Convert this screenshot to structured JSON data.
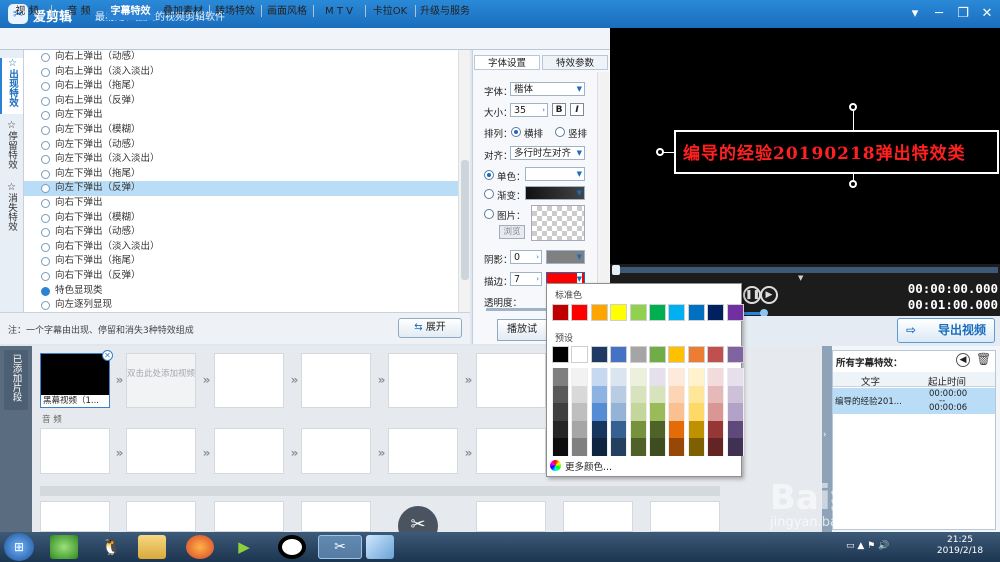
{
  "app": {
    "logo_glyph": "✂",
    "title": "爱剪辑",
    "subtitle": "最易用、强大的视频剪辑软件"
  },
  "tabs": [
    {
      "label": "视  频"
    },
    {
      "label": "音  频"
    },
    {
      "label": "字幕特效"
    },
    {
      "label": "叠加素材"
    },
    {
      "label": "转场特效"
    },
    {
      "label": "画面风格"
    },
    {
      "label": "M T V"
    },
    {
      "label": "卡拉OK"
    },
    {
      "label": "升级与服务"
    }
  ],
  "side_tabs": [
    {
      "label": "出现特效"
    },
    {
      "label": "停留特效"
    },
    {
      "label": "消失特效"
    }
  ],
  "effects": [
    {
      "label": "向右上弹出（动感）"
    },
    {
      "label": "向右上弹出（淡入淡出）"
    },
    {
      "label": "向右上弹出（拖尾）"
    },
    {
      "label": "向右上弹出（反弹）"
    },
    {
      "label": "向左下弹出"
    },
    {
      "label": "向左下弹出（模糊）"
    },
    {
      "label": "向左下弹出（动感）"
    },
    {
      "label": "向左下弹出（淡入淡出）"
    },
    {
      "label": "向左下弹出（拖尾）"
    },
    {
      "label": "向左下弹出（反弹）"
    },
    {
      "label": "向右下弹出"
    },
    {
      "label": "向右下弹出（模糊）"
    },
    {
      "label": "向右下弹出（动感）"
    },
    {
      "label": "向右下弹出（淡入淡出）"
    },
    {
      "label": "向右下弹出（拖尾）"
    },
    {
      "label": "向右下弹出（反弹）"
    }
  ],
  "effect_selected": "向左下弹出（反弹）",
  "category": {
    "label": "特色显现类",
    "first_item": "向左逐列显现"
  },
  "note": "注：一个字幕由出现、停留和消失3种特效组成",
  "expand_label": "展开",
  "props": {
    "tab_font": "字体设置",
    "tab_effect": "特效参数",
    "font_label": "字体：",
    "font_value": "楷体",
    "size_label": "大小：",
    "size_value": "35",
    "bold": "B",
    "italic": "I",
    "layout_label": "排列：",
    "layout_h": "横排",
    "layout_v": "竖排",
    "align_label": "对齐：",
    "align_value": "多行时左对齐",
    "solid_label": "单色：",
    "gradient_label": "渐变：",
    "image_label": "图片：",
    "browse_label": "浏览",
    "shadow_label": "阴影：",
    "shadow_value": "0",
    "stroke_label": "描边：",
    "stroke_value": "7",
    "opacity_label": "透明度："
  },
  "preview": {
    "caption": "编导的经验20190218弹出特效类"
  },
  "time": {
    "current": "00:00:00.000",
    "total": "00:01:00.000"
  },
  "play_label": "播放试",
  "export_label": "导出视频",
  "timeline": {
    "section_label": "已添加片段",
    "clip_label": "黑幕视频（1...",
    "add_hint": "双击此处添加视频",
    "audio_label": "音  频"
  },
  "right_panel": {
    "title": "所有字幕特效：",
    "col_text": "文字",
    "col_time": "起止时间",
    "row_text": "编导的经验201...",
    "row_start": "00:00:00",
    "row_sep": "--",
    "row_end": "00:00:06"
  },
  "palette": {
    "standard_label": "标准色",
    "preset_label": "预设",
    "more_label": "更多颜色...",
    "standard": [
      "#c00000",
      "#ff0000",
      "#ffa500",
      "#ffff00",
      "#92d050",
      "#00b050",
      "#00b0f0",
      "#0070c0",
      "#002060",
      "#7030a0"
    ],
    "preset_top": [
      "#000000",
      "#ffffff",
      "#1f3864",
      "#4472c4",
      "#a5a5a5",
      "#70ad47",
      "#ffc000",
      "#ed7d31",
      "#c0504d",
      "#8064a2"
    ],
    "preset_cols": [
      [
        "#7f7f7f",
        "#595959",
        "#3f3f3f",
        "#262626",
        "#0d0d0d"
      ],
      [
        "#f2f2f2",
        "#d9d9d9",
        "#bfbfbf",
        "#a6a6a6",
        "#808080"
      ],
      [
        "#c6d9f0",
        "#8db3e2",
        "#548dd4",
        "#17365d",
        "#0f243e"
      ],
      [
        "#dbe5f1",
        "#b8cce4",
        "#95b3d7",
        "#366092",
        "#244061"
      ],
      [
        "#ebf1dd",
        "#d7e3bc",
        "#c3d69b",
        "#76923c",
        "#4f6128"
      ],
      [
        "#e6e0ec",
        "#d6e3bc",
        "#9bbb59",
        "#4f6228",
        "#3d4d1f"
      ],
      [
        "#fdeada",
        "#fbd5b5",
        "#fac08f",
        "#e36c09",
        "#974806"
      ],
      [
        "#fff2cc",
        "#ffe699",
        "#ffd966",
        "#bf9000",
        "#7f6000"
      ],
      [
        "#f2dcdb",
        "#e5b9b7",
        "#d99694",
        "#953734",
        "#632423"
      ],
      [
        "#e5e0ec",
        "#ccc1d9",
        "#b2a2c7",
        "#5f497a",
        "#3f3151"
      ]
    ]
  },
  "colors": {
    "stroke": "#ff0000",
    "shadow": "#808080",
    "solid": "#ffffff",
    "gradient": "#111111",
    "accent": "#2a82d4"
  },
  "taskbar": {
    "time": "21:25",
    "date": "2019/2/18"
  },
  "watermark": {
    "logo": "Bai经验",
    "url": "jingyan.baidu.com"
  }
}
